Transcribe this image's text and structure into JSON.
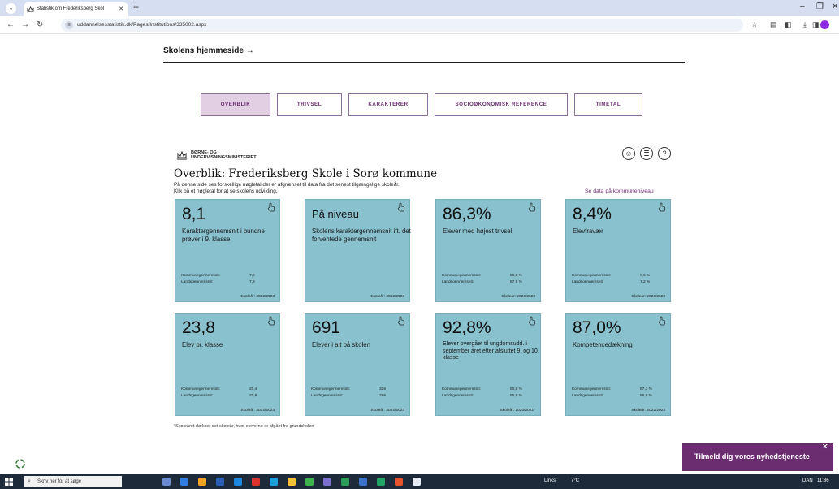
{
  "browser": {
    "tab_title": "Statistik om Frederiksberg Skol",
    "url": "uddannelsesstatistik.dk/Pages/Institutions/335002.aspx"
  },
  "header": {
    "homepage_link": "Skolens hjemmeside"
  },
  "nav_tabs": [
    {
      "label": "OVERBLIK"
    },
    {
      "label": "TRIVSEL"
    },
    {
      "label": "KARAKTERER"
    },
    {
      "label": "SOCIOØKONOMISK REFERENCE"
    },
    {
      "label": "TIMETAL"
    }
  ],
  "ministry": {
    "line1": "BØRNE- OG",
    "line2": "UNDERVISNINGSMINISTERIET"
  },
  "main": {
    "title": "Overblik: Frederiksberg Skole i Sorø kommune",
    "intro_line1": "På denne side ses forskellige nøgletal der er afgrænset til data fra det senest tilgængelige skoleår.",
    "intro_line2": "Klik på et nøgletal for at se skolens udvikling.",
    "kommune_link": "Se data på kommuneniveau",
    "footnote": "*Skoleåret dækker det skoleår, hvor eleverne er afgået fra grundskolen"
  },
  "labels": {
    "kommune": "Kommunegennemsnit:",
    "lands": "Landsgennemsnit:"
  },
  "cards": [
    {
      "value": "8,1",
      "description": "Karaktergennemsnit i bundne prøver i 9. klasse",
      "kommune": "7,3",
      "lands": "7,3",
      "year": "Skoleår: 2022/2023"
    },
    {
      "value": "På niveau",
      "description": "Skolens karaktergennemsnit ift. det forventede gennemsnit",
      "year": "Skoleår: 2022/2023"
    },
    {
      "value": "86,3%",
      "description": "Elever med højest trivsel",
      "kommune": "80,8 %",
      "lands": "87,5 %",
      "year": "Skoleår: 2022/2023"
    },
    {
      "value": "8,4%",
      "description": "Elevfravær",
      "kommune": "9,6 %",
      "lands": "7,2 %",
      "year": "Skoleår: 2022/2023"
    },
    {
      "value": "23,8",
      "description": "Elev pr. klasse",
      "kommune": "20,4",
      "lands": "20,9",
      "year": "Skoleår: 2022/2023"
    },
    {
      "value": "691",
      "description": "Elever i alt på skolen",
      "kommune": "328",
      "lands": "296",
      "year": "Skoleår: 2022/2023"
    },
    {
      "value": "92,8%",
      "description": "Elever overgået til ungdomsudd. i september året efter afsluttet 9. og 10. klasse",
      "kommune": "80,6 %",
      "lands": "85,8 %",
      "year": "Skoleår: 2020/2021*"
    },
    {
      "value": "87,0%",
      "description": "Kompetencedækning",
      "kommune": "87,3 %",
      "lands": "86,6 %",
      "year": "Skoleår: 2022/2023"
    }
  ],
  "newsletter": {
    "label": "Tilmeld dig vores nyhedstjeneste"
  },
  "taskbar": {
    "search_placeholder": "Skriv her for at søge",
    "links_label": "Links",
    "weather": "7°C",
    "language": "DAN",
    "time": "11:36"
  },
  "colors": {
    "card_bg": "#89c2ce",
    "accent_purple": "#6b2c70",
    "active_tab_bg": "#e3cfe3"
  }
}
